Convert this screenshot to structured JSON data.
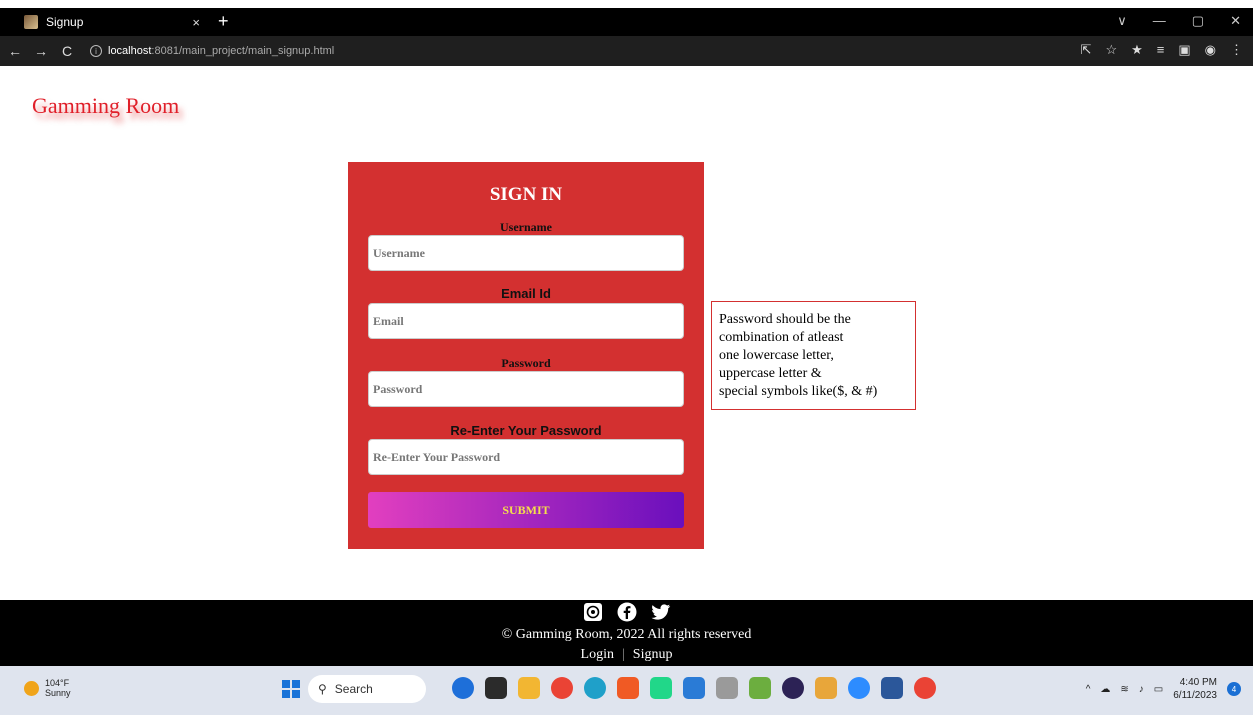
{
  "browser": {
    "tab_title": "Signup",
    "tab_close": "×",
    "new_tab": "+",
    "url_host": "localhost",
    "url_path": ":8081/main_project/main_signup.html",
    "nav": {
      "back": "←",
      "forward": "→",
      "reload": "C"
    },
    "window_controls": {
      "dropdown": "∨",
      "minimize": "—",
      "maximize": "▢",
      "close": "✕"
    }
  },
  "page": {
    "brand": "Gamming Room",
    "form": {
      "title": "SIGN IN",
      "username_label": "Username",
      "username_placeholder": "Username",
      "email_label": "Email Id",
      "email_placeholder": "Email",
      "password_label": "Password",
      "password_placeholder": "Password",
      "repassword_label": "Re-Enter Your Password",
      "repassword_placeholder": "Re-Enter Your Password",
      "submit_label": "SUBMIT"
    },
    "hint_lines": [
      "Password should be the",
      "combination of atleast",
      "one lowercase letter,",
      "uppercase letter &",
      "special symbols like($, & #)"
    ]
  },
  "footer": {
    "copyright": "© Gamming Room, 2022 All rights reserved",
    "login": "Login",
    "separator": "|",
    "signup": "Signup",
    "social_icons": [
      "whatsapp-icon",
      "facebook-icon",
      "twitter-icon"
    ]
  },
  "taskbar": {
    "temperature": "104°F",
    "weather": "Sunny",
    "search": "Search",
    "time": "4:40 PM",
    "date": "6/11/2023",
    "notifications": "4"
  },
  "colors": {
    "accent_red": "#d33030",
    "brand_red": "#e0202a",
    "submit_gradient_start": "#e23fbf",
    "submit_gradient_end": "#6a0fbd",
    "submit_text": "#f5e04a"
  }
}
